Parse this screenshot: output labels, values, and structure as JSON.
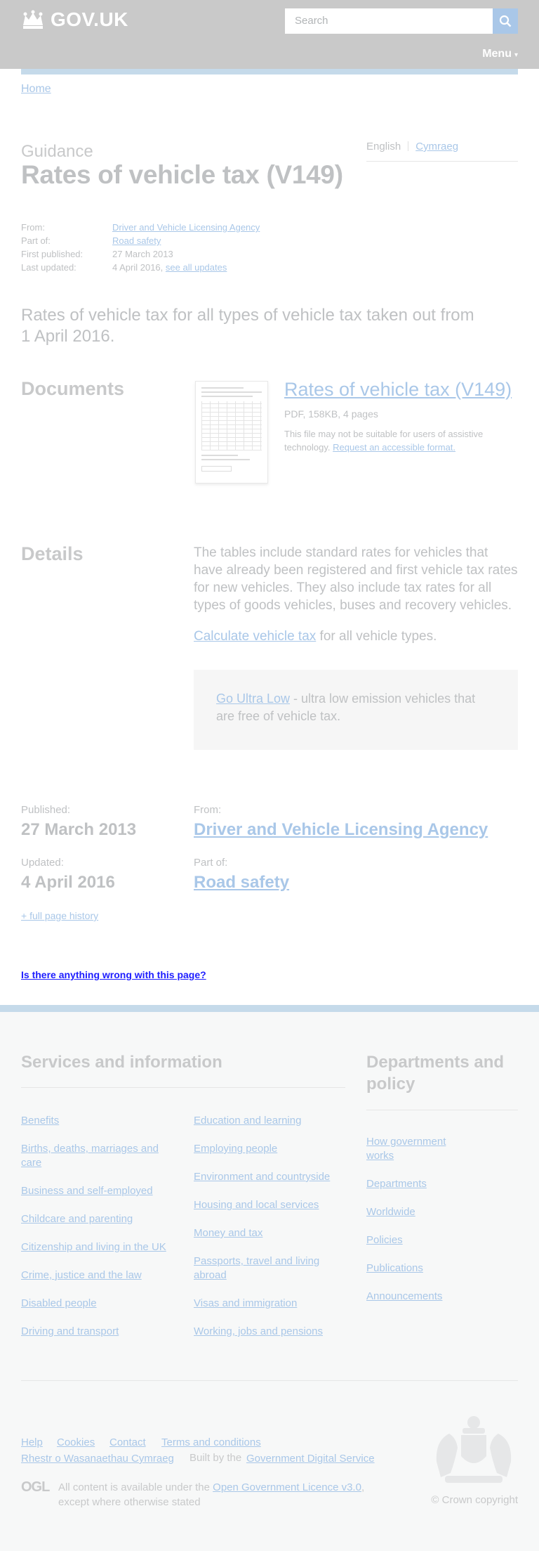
{
  "header": {
    "logo_text": "GOV.UK",
    "search_placeholder": "Search",
    "menu_label": "Menu",
    "menu_caret": "▾"
  },
  "breadcrumb": {
    "home": "Home"
  },
  "page": {
    "kicker": "Guidance",
    "title": "Rates of vehicle tax (V149)",
    "languages": {
      "english": "English",
      "welsh": "Cymraeg"
    }
  },
  "metadata": {
    "from_label": "From:",
    "from_value": "Driver and Vehicle Licensing Agency",
    "partof_label": "Part of:",
    "partof_value": "Road safety",
    "first_published_label": "First published:",
    "first_published_value": "27 March 2013",
    "last_updated_label": "Last updated:",
    "last_updated_value": "4 April 2016,",
    "see_all_updates": "see all updates"
  },
  "lead": "Rates of vehicle tax for all types of vehicle tax taken out from 1 April 2016.",
  "documents": {
    "heading": "Documents",
    "title": "Rates of vehicle tax (V149)",
    "meta": "PDF, 158KB, 4 pages",
    "note": "This file may not be suitable for users of assistive technology.",
    "note_link": "Request an accessible format."
  },
  "details": {
    "heading": "Details",
    "body": "The tables include standard rates for vehicles that have already been registered and first vehicle tax rates for new vehicles. They also include tax rates for all types of goods vehicles, buses and recovery vehicles.",
    "calc_link": "Calculate vehicle tax",
    "calc_rest": " for all vehicle types.",
    "callout_link": "Go Ultra Low",
    "callout_rest": " - ultra low emission vehicles that are free of vehicle tax."
  },
  "published_block": {
    "published_label": "Published:",
    "published_value": "27 March 2013",
    "updated_label": "Updated:",
    "updated_value": "4 April 2016",
    "from_label": "From:",
    "from_value": "Driver and Vehicle Licensing Agency",
    "partof_label": "Part of:",
    "partof_value": "Road safety",
    "history_link": "+ full page history"
  },
  "report_link": "Is there anything wrong with this page?",
  "footer": {
    "services_heading": "Services and information",
    "services_col1": [
      "Benefits",
      "Births, deaths, marriages and care",
      "Business and self-employed",
      "Childcare and parenting",
      "Citizenship and living in the UK",
      "Crime, justice and the law",
      "Disabled people",
      "Driving and transport"
    ],
    "services_col2": [
      "Education and learning",
      "Employing people",
      "Environment and countryside",
      "Housing and local services",
      "Money and tax",
      "Passports, travel and living abroad",
      "Visas and immigration",
      "Working, jobs and pensions"
    ],
    "departments_heading": "Departments and policy",
    "departments": [
      "How government works",
      "Departments",
      "Worldwide",
      "Policies",
      "Publications",
      "Announcements"
    ],
    "meta_links": [
      "Help",
      "Cookies",
      "Contact",
      "Terms and conditions"
    ],
    "welsh_link": "Rhestr o Wasanaethau Cymraeg",
    "built_by_prefix": "Built by the",
    "built_by_link": "Government Digital Service",
    "ogl_logo": "OGL",
    "licence_prefix": "All content is available under the",
    "licence_link": "Open Government Licence v3.0",
    "licence_suffix": ", except where otherwise stated",
    "copyright": "© Crown copyright"
  }
}
